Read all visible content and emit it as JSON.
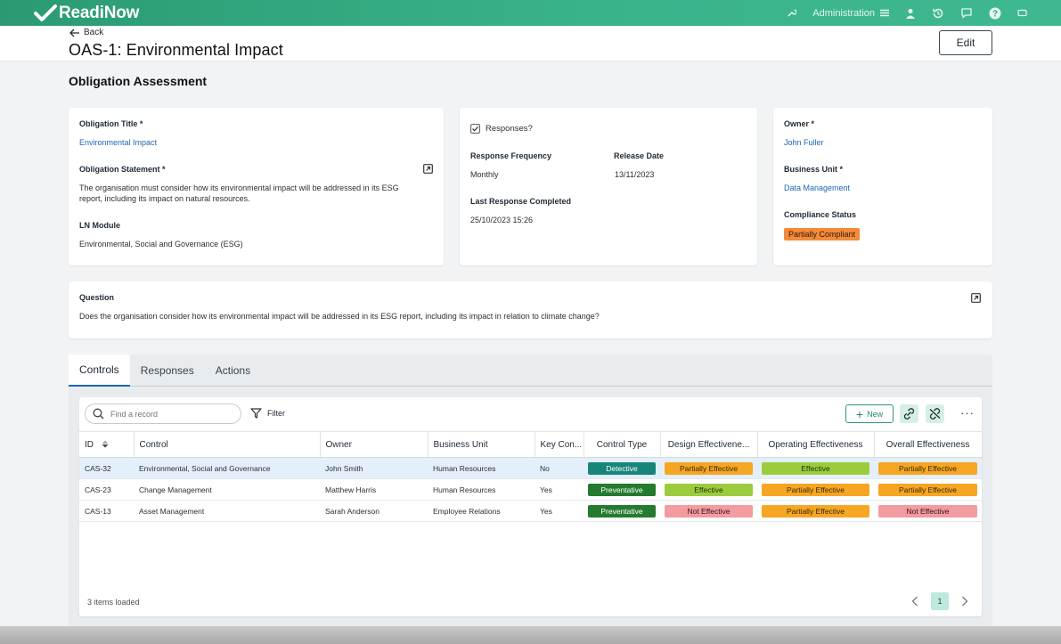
{
  "app": {
    "name": "ReadiNow"
  },
  "topnav": {
    "admin_label": "Administration"
  },
  "colors": {
    "brand": "#39b38a",
    "link": "#1d66b3",
    "compliance_partial": "#f58a3a"
  },
  "header": {
    "back_label": "Back",
    "title": "OAS-1: Environmental Impact",
    "edit_label": "Edit"
  },
  "section": {
    "title": "Obligation Assessment"
  },
  "card1": {
    "obligation_title_label": "Obligation Title",
    "obligation_title_value": "Environmental Impact",
    "statement_label": "Obligation Statement",
    "statement_line1": "The organisation must consider how its environmental impact will be addressed in its ESG",
    "statement_line2": "report, including its impact on natural resources.",
    "module_label": "LN Module",
    "module_value": "Environmental, Social and Governance (ESG)"
  },
  "card2": {
    "responses_label": "Responses?",
    "frequency_label": "Response Frequency",
    "frequency_value": "Monthly",
    "release_label": "Release Date",
    "release_value": "13/11/2023",
    "last_label": "Last Response Completed",
    "last_value": "25/10/2023 15:26"
  },
  "card3": {
    "owner_label": "Owner",
    "owner_value": "John Fuller",
    "bu_label": "Business Unit",
    "bu_value": "Data Management",
    "status_label": "Compliance Status",
    "status_value": "Partially Compliant"
  },
  "question": {
    "label": "Question",
    "text": "Does the organisation consider how its environmental impact will be addressed in its ESG report, including its impact in relation to climate change?"
  },
  "required_mark": "*",
  "tabs": [
    {
      "label": "Controls"
    },
    {
      "label": "Responses"
    },
    {
      "label": "Actions"
    }
  ],
  "grid": {
    "search_placeholder": "Find a record",
    "filter_label": "Filter",
    "new_label": "New",
    "more_label": "···",
    "columns": [
      "ID",
      "Control",
      "Owner",
      "Business Unit",
      "Key Con...",
      "Control Type",
      "Design Effectivene...",
      "Operating Effectiveness",
      "Overall Effectiveness"
    ],
    "rows": [
      {
        "id": "CAS-32",
        "control": "Environmental, Social and Governance",
        "owner": "John Smith",
        "bu": "Human Resources",
        "key": "No",
        "type": "Detective",
        "design": "Partially Effective",
        "operating": "Effective",
        "overall": "Partially Effective"
      },
      {
        "id": "CAS-23",
        "control": "Change Management",
        "owner": "Matthew Harris",
        "bu": "Human Resources",
        "key": "Yes",
        "type": "Preventative",
        "design": "Effective",
        "operating": "Partially Effective",
        "overall": "Partially Effective"
      },
      {
        "id": "CAS-13",
        "control": "Asset Management",
        "owner": "Sarah Anderson",
        "bu": "Employee Relations",
        "key": "Yes",
        "type": "Preventative",
        "design": "Not Effective",
        "operating": "Partially Effective",
        "overall": "Not Effective"
      }
    ],
    "items_loaded": "3 items loaded",
    "current_page": "1"
  }
}
